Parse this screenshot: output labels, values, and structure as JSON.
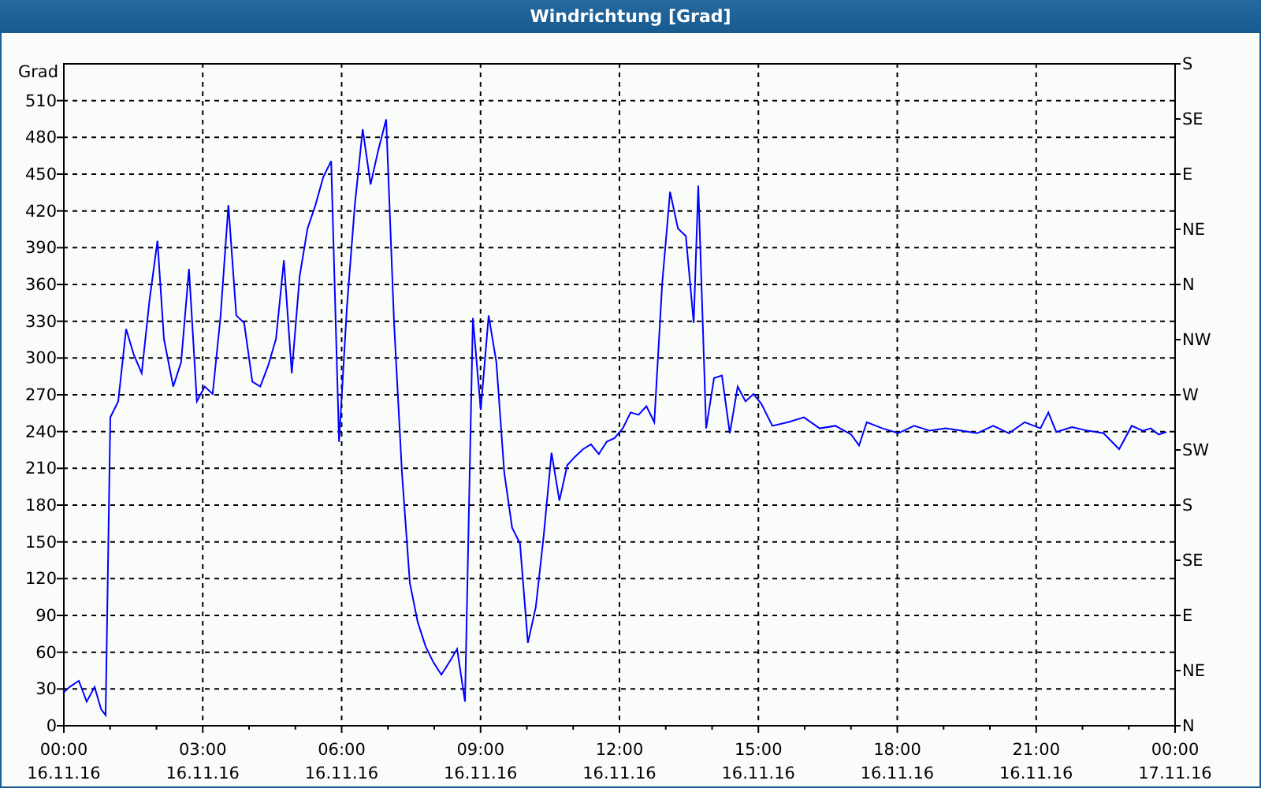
{
  "window": {
    "title": "Windrichtung [Grad]"
  },
  "chart": {
    "compass_labels": [
      "S",
      "SE",
      "E",
      "NE",
      "N",
      "NW",
      "W",
      "SW",
      "S",
      "SE",
      "E",
      "NE",
      "N"
    ],
    "date_labels": [
      "16.11.16",
      "16.11.16",
      "16.11.16",
      "16.11.16",
      "16.11.16",
      "16.11.16",
      "16.11.16",
      "16.11.16",
      "17.11.16"
    ],
    "chart_data": {
      "type": "line",
      "grid": true,
      "ylabel": "Grad",
      "xlim": [
        0,
        24
      ],
      "ylim": [
        0,
        540
      ],
      "yticks": [
        0,
        30,
        60,
        90,
        120,
        150,
        180,
        210,
        240,
        270,
        300,
        330,
        360,
        390,
        420,
        450,
        480,
        510
      ],
      "xticks": [
        {
          "value": 0,
          "label": "00:00"
        },
        {
          "value": 3,
          "label": "03:00"
        },
        {
          "value": 6,
          "label": "06:00"
        },
        {
          "value": 9,
          "label": "09:00"
        },
        {
          "value": 12,
          "label": "12:00"
        },
        {
          "value": 15,
          "label": "15:00"
        },
        {
          "value": 18,
          "label": "18:00"
        },
        {
          "value": 21,
          "label": "21:00"
        },
        {
          "value": 24,
          "label": "00:00"
        }
      ],
      "x": [
        0,
        0.14,
        0.34,
        0.51,
        0.68,
        0.82,
        0.92,
        1.02,
        1.19,
        1.36,
        1.53,
        1.7,
        1.87,
        2.04,
        2.18,
        2.38,
        2.55,
        2.72,
        2.89,
        3.06,
        3.23,
        3.4,
        3.57,
        3.74,
        3.91,
        4.09,
        4.26,
        4.43,
        4.6,
        4.77,
        4.94,
        5.11,
        5.28,
        5.45,
        5.62,
        5.79,
        5.96,
        6.13,
        6.3,
        6.47,
        6.64,
        6.81,
        6.98,
        7.15,
        7.32,
        7.49,
        7.66,
        7.83,
        8.0,
        8.17,
        8.34,
        8.51,
        8.68,
        8.85,
        9.02,
        9.19,
        9.36,
        9.53,
        9.7,
        9.87,
        10.04,
        10.21,
        10.38,
        10.55,
        10.72,
        10.89,
        11.06,
        11.23,
        11.4,
        11.57,
        11.74,
        11.91,
        12.09,
        12.26,
        12.43,
        12.6,
        12.77,
        12.94,
        13.11,
        13.28,
        13.45,
        13.62,
        13.72,
        13.89,
        14.06,
        14.23,
        14.4,
        14.57,
        14.74,
        14.91,
        15.08,
        15.32,
        15.66,
        16.0,
        16.34,
        16.68,
        17.02,
        17.19,
        17.36,
        17.7,
        18.04,
        18.38,
        18.72,
        19.06,
        19.4,
        19.74,
        20.09,
        20.43,
        20.77,
        21.11,
        21.28,
        21.45,
        21.79,
        22.13,
        22.47,
        22.81,
        23.08,
        23.32,
        23.49,
        23.66,
        23.83
      ],
      "series": [
        {
          "color": "#0000ff",
          "values": [
            26,
            31,
            36,
            19,
            31,
            13,
            8,
            251,
            264,
            323,
            302,
            287,
            347,
            395,
            315,
            276,
            296,
            372,
            264,
            276,
            270,
            333,
            424,
            334,
            328,
            280,
            276,
            293,
            315,
            379,
            287,
            366,
            405,
            424,
            447,
            460,
            231,
            341,
            424,
            486,
            441,
            469,
            494,
            328,
            206,
            116,
            84,
            64,
            51,
            41,
            51,
            62,
            19,
            332,
            257,
            334,
            296,
            206,
            161,
            148,
            67,
            96,
            154,
            222,
            183,
            212,
            219,
            225,
            229,
            221,
            231,
            234,
            242,
            255,
            253,
            260,
            247,
            360,
            435,
            405,
            399,
            328,
            440,
            242,
            283,
            285,
            238,
            276,
            264,
            270,
            262,
            244,
            247,
            251,
            242,
            244,
            237,
            228,
            247,
            242,
            238,
            244,
            240,
            242,
            240,
            238,
            244,
            238,
            247,
            242,
            255,
            239,
            243,
            240,
            238,
            225,
            244,
            240,
            242,
            237,
            239
          ]
        }
      ]
    }
  }
}
